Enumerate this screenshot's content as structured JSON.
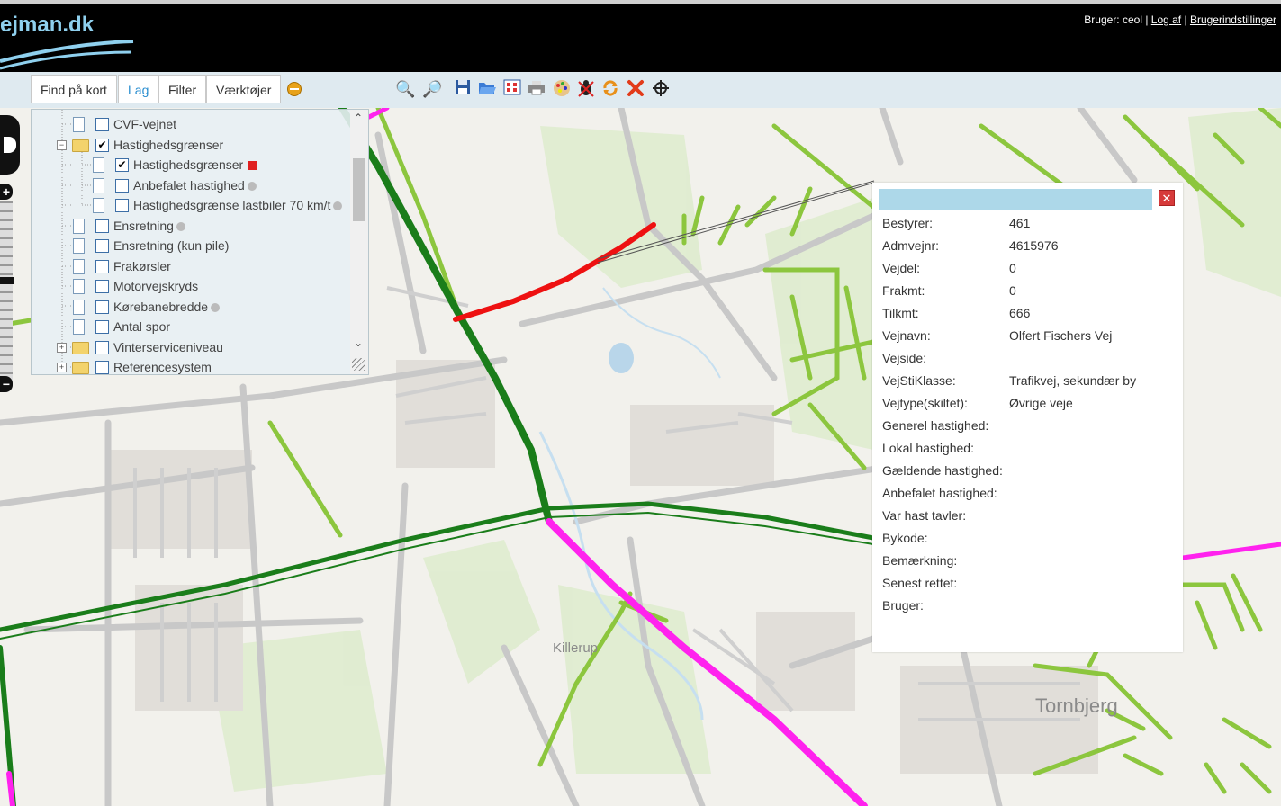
{
  "header": {
    "logo_text": "ejman.dk",
    "user_label": "Bruger: ceol",
    "logout_link": "Log af",
    "settings_link": "Brugerindstillinger"
  },
  "tabs": [
    "Find på kort",
    "Lag",
    "Filter",
    "Værktøjer"
  ],
  "tools": [
    "zoom-out-icon",
    "zoom-in-icon",
    "save-icon",
    "open-icon",
    "grid-icon",
    "print-icon",
    "palette-icon",
    "bug-icon",
    "refresh-icon",
    "delete-icon",
    "crosshair-icon"
  ],
  "layers": [
    {
      "label": "CVF-vejnet",
      "checked": false
    },
    {
      "label": "Hastighedsgrænser",
      "checked": true,
      "folder": true
    },
    {
      "label": "Hastighedsgrænser",
      "checked": true,
      "color": "#e02020"
    },
    {
      "label": "Anbefalet hastighed",
      "checked": false,
      "info": true
    },
    {
      "label": "Hastighedsgrænse lastbiler 70 km/t",
      "checked": false,
      "info": true
    },
    {
      "label": "Ensretning",
      "checked": false,
      "info": true
    },
    {
      "label": "Ensretning (kun pile)",
      "checked": false
    },
    {
      "label": "Frakørsler",
      "checked": false
    },
    {
      "label": "Motorvejskryds",
      "checked": false
    },
    {
      "label": "Kørebanebredde",
      "checked": false,
      "info": true
    },
    {
      "label": "Antal spor",
      "checked": false
    },
    {
      "label": "Vinterserviceniveau",
      "checked": false,
      "folder": true
    },
    {
      "label": "Referencesystem",
      "checked": false,
      "folder": true
    }
  ],
  "map_labels": {
    "place1": "Killerup",
    "place2": "Tornbjerg"
  },
  "popup": {
    "rows": [
      {
        "key": "Bestyrer:",
        "value": "461"
      },
      {
        "key": "Admvejnr:",
        "value": "4615976"
      },
      {
        "key": "Vejdel:",
        "value": "0"
      },
      {
        "key": "Frakmt:",
        "value": "0"
      },
      {
        "key": "Tilkmt:",
        "value": "666"
      },
      {
        "key": "Vejnavn:",
        "value": "Olfert Fischers Vej"
      },
      {
        "key": "Vejside:",
        "value": ""
      },
      {
        "key": "VejStiKlasse:",
        "value": "Trafikvej, sekundær by"
      },
      {
        "key": "Vejtype(skiltet):",
        "value": "Øvrige veje"
      },
      {
        "key": "Generel hastighed:",
        "value": ""
      },
      {
        "key": "Lokal hastighed:",
        "value": ""
      },
      {
        "key": "Gældende hastighed:",
        "value": ""
      },
      {
        "key": "Anbefalet hastighed:",
        "value": ""
      },
      {
        "key": "Var hast tavler:",
        "value": ""
      },
      {
        "key": "Bykode:",
        "value": ""
      },
      {
        "key": "Bemærkning:",
        "value": ""
      },
      {
        "key": "Senest rettet:",
        "value": ""
      },
      {
        "key": "Bruger:",
        "value": ""
      }
    ]
  },
  "colors": {
    "speed_red": "#ee1111",
    "road_dark_green": "#1a7d1a",
    "road_light_green": "#8cc63e",
    "road_magenta": "#ff22ee"
  }
}
